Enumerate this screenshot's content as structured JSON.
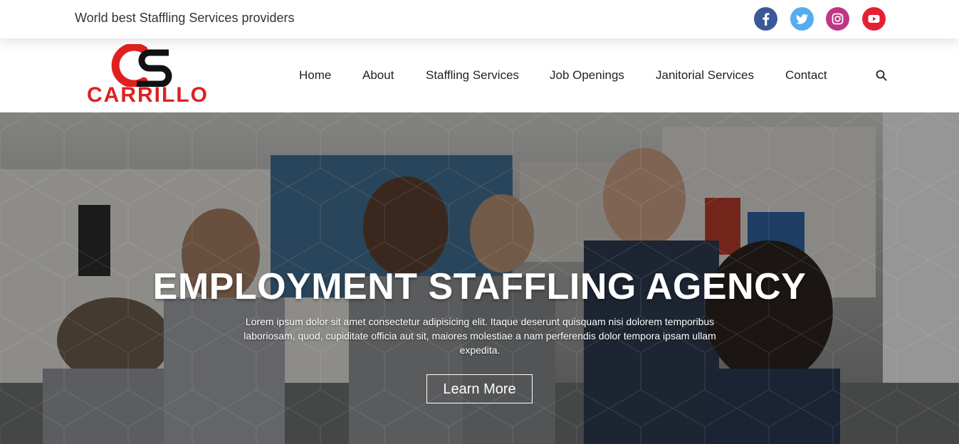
{
  "topbar": {
    "tagline": "World best Staffling Services providers",
    "social": [
      {
        "name": "facebook-icon",
        "color": "#3b5998"
      },
      {
        "name": "twitter-icon",
        "color": "#55acee"
      },
      {
        "name": "instagram-icon",
        "color": "#c13584"
      },
      {
        "name": "youtube-icon",
        "color": "#e62033"
      }
    ]
  },
  "header": {
    "logo_text": "CARRILLO",
    "nav": [
      "Home",
      "About",
      "Staffling Services",
      "Job Openings",
      "Janitorial Services",
      "Contact"
    ],
    "search_icon": "search-icon"
  },
  "hero": {
    "title": "EMPLOYMENT STAFFLING AGENCY",
    "text": "Lorem ipsum dolor sit amet consectetur adipisicing elit. Itaque deserunt quisquam nisi dolorem temporibus laboriosam, quod, cupiditate officia aut sit, maiores molestiae a nam perferendis dolor tempora ipsam ullam expedita.",
    "button": "Learn More"
  },
  "colors": {
    "brand_red": "#e02020",
    "dark": "#222222"
  }
}
